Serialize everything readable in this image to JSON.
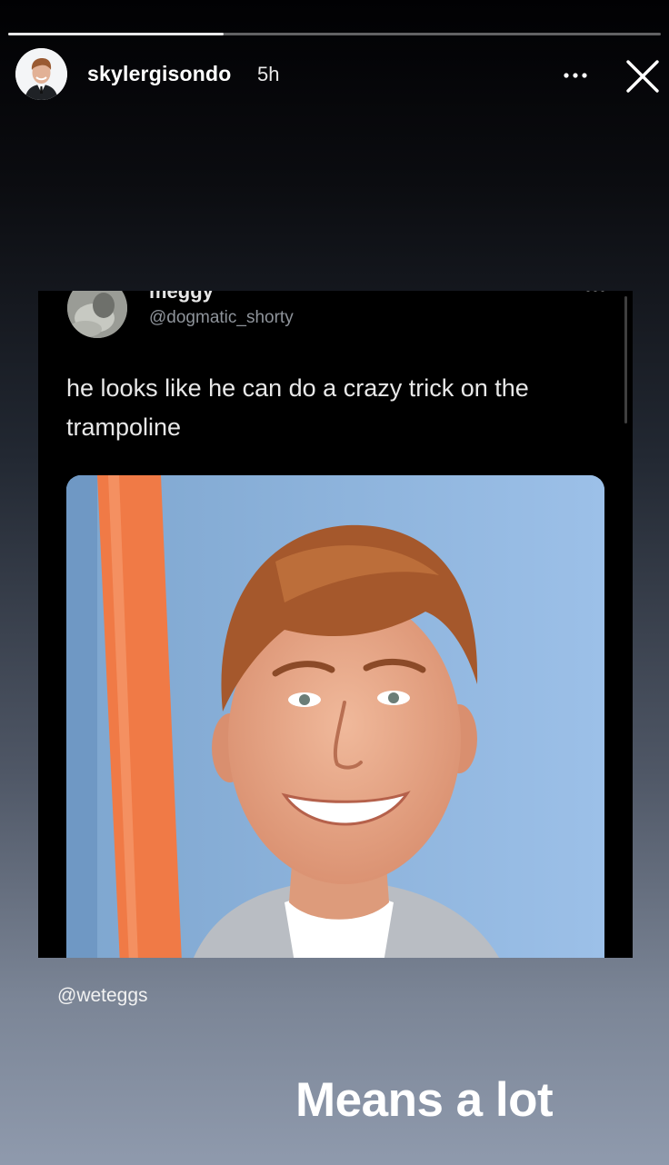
{
  "story": {
    "progress": 0.33,
    "username": "skylergisondo",
    "timestamp": "5h",
    "more_icon": "more-horizontal-icon",
    "close_icon": "close-icon",
    "avatar_icon": "profile-photo"
  },
  "tweet": {
    "display_name": "meggy",
    "handle": "@dogmatic_shorty",
    "text": "he looks like he can do a crazy trick on the trampoline",
    "more_icon": "more-horizontal-icon",
    "photo_icon": "portrait-photo"
  },
  "mention": "@weteggs",
  "caption": "Means a lot",
  "colors": {
    "background_top": "#010103",
    "background_bottom": "#8f9aad",
    "tweet_background": "#000000",
    "handle_gray": "#8e939a",
    "photo_background": "#8fb3df",
    "photo_stripe": "#f07a46"
  }
}
